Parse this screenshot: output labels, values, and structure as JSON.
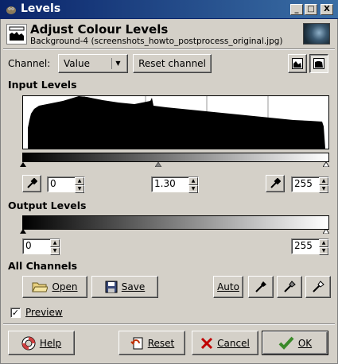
{
  "window": {
    "title": "Levels",
    "minimize": "_",
    "maximize": "□",
    "close": "X"
  },
  "header": {
    "title": "Adjust Colour Levels",
    "subtitle": "Background-4 (screenshots_howto_postprocess_original.jpg)"
  },
  "channel": {
    "label": "Channel:",
    "value": "Value",
    "reset_label": "Reset channel"
  },
  "input_levels": {
    "label": "Input Levels",
    "black": "0",
    "gamma": "1.30",
    "white": "255"
  },
  "output_levels": {
    "label": "Output Levels",
    "black": "0",
    "white": "255"
  },
  "all_channels": {
    "label": "All Channels",
    "open_label": "Open",
    "save_label": "Save",
    "auto_label": "Auto"
  },
  "preview": {
    "label": "Preview",
    "checked": true,
    "check_glyph": "✓"
  },
  "footer": {
    "help_label": "Help",
    "reset_label": "Reset",
    "cancel_label": "Cancel",
    "ok_label": "OK"
  },
  "colors": {
    "titlebar": "#0a246a",
    "face": "#d4d0c8",
    "cancel_icon": "#c00000",
    "ok_icon": "#3a8a2a"
  },
  "icons": [
    "gimp-icon",
    "levels-icon",
    "linear-histogram-icon",
    "log-histogram-icon",
    "eyedropper-icon",
    "folder-icon",
    "floppy-icon",
    "lifebuoy-icon",
    "undo-icon",
    "cross-icon",
    "check-icon"
  ]
}
